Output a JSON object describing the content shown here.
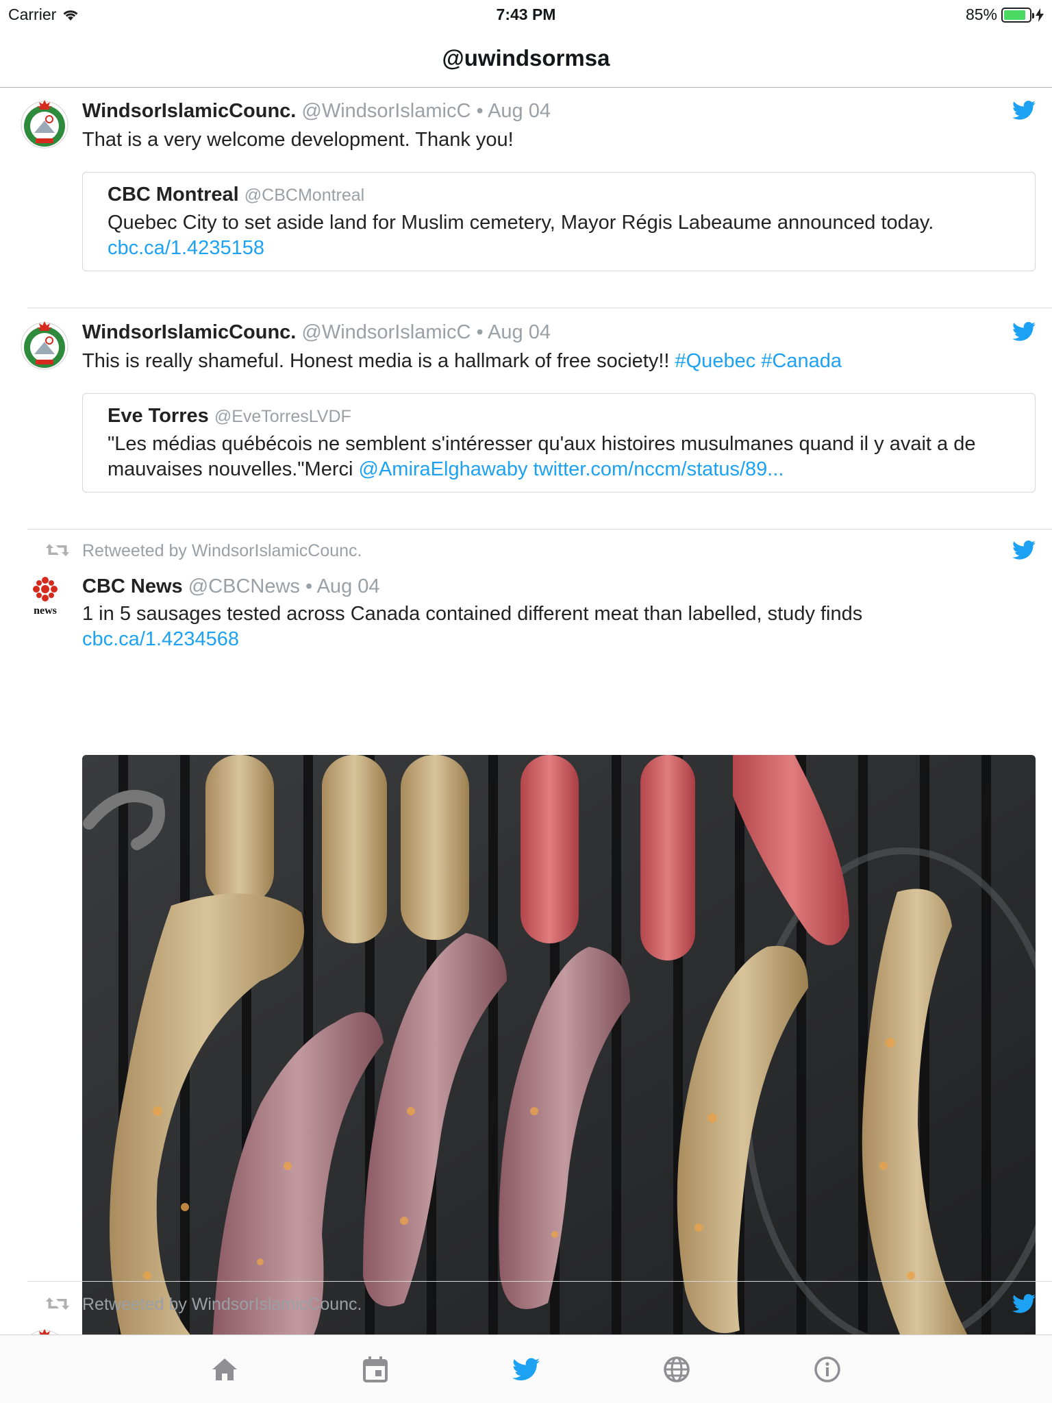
{
  "status_bar": {
    "carrier": "Carrier",
    "time": "7:43 PM",
    "battery": "85%",
    "battery_level": 0.85
  },
  "nav": {
    "title": "@uwindsormsa"
  },
  "colors": {
    "link": "#1da1f2",
    "muted": "#99a0a6",
    "active_tab": "#1da1f2"
  },
  "tweets": [
    {
      "author": "WindsorIslamicCounc.",
      "handle": "@WindsorIslamicC",
      "dot": "•",
      "date": "Aug 04",
      "text": "That is a very welcome development. Thank you!",
      "quote": {
        "author": "CBC Montreal",
        "handle": "@CBCMontreal",
        "text": "Quebec City to set aside land for Muslim cemetery, Mayor Régis Labeaume announced today.",
        "link": "cbc.ca/1.4235158"
      }
    },
    {
      "author": "WindsorIslamicCounc.",
      "handle": "@WindsorIslamicC",
      "dot": "•",
      "date": "Aug 04",
      "text": "This is really shameful. Honest media is a hallmark of free society!! ",
      "hashtag1": "#Quebec",
      "hashtag2": "#Canada",
      "quote": {
        "author": "Eve Torres",
        "handle": "@EveTorresLVDF",
        "text": "\"Les médias québécois ne semblent s'intéresser qu'aux histoires musulmanes quand il y avait a de mauvaises nouvelles.\"Merci ",
        "mention": "@AmiraElghawaby",
        "link": "twitter.com/nccm/status/89..."
      }
    },
    {
      "retweeted_by": "Retweeted by WindsorIslamicCounc.",
      "author": "CBC News",
      "handle": "@CBCNews",
      "dot": "•",
      "date": "Aug 04",
      "avatar_label": "news",
      "text": "1 in 5 sausages tested across Canada contained different meat than labelled, study finds ",
      "link": "cbc.ca/1.4234568"
    },
    {
      "retweeted_by": "Retweeted by WindsorIslamicCounc."
    }
  ],
  "tabs": [
    {
      "name": "home-icon"
    },
    {
      "name": "calendar-icon"
    },
    {
      "name": "twitter-icon",
      "active": true
    },
    {
      "name": "globe-icon"
    },
    {
      "name": "info-icon"
    }
  ]
}
